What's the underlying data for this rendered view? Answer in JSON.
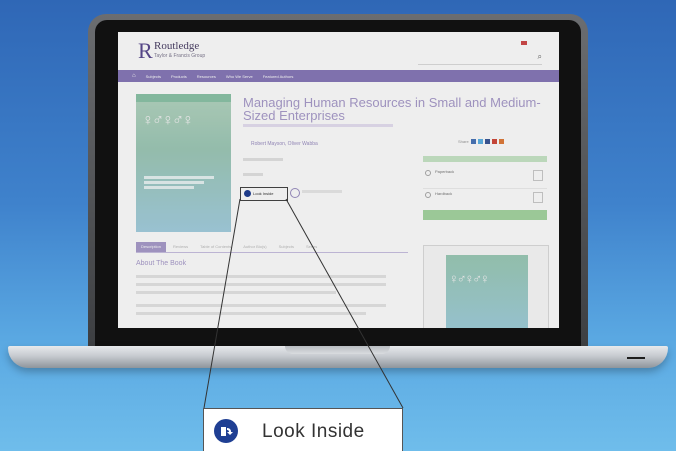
{
  "site": {
    "logo_letter": "R",
    "logo_name": "Routledge",
    "logo_tagline": "Taylor & Francis Group",
    "header_links": [
      "",
      "",
      ""
    ],
    "search_placeholder": ""
  },
  "nav": {
    "items": [
      "Subjects",
      "Products",
      "Resources",
      "Who We Serve",
      "Featured Authors"
    ]
  },
  "book": {
    "title": "Managing Human Resources in Small and Medium-Sized Enterprises",
    "authors": "Robert Mayson, Oliver Wabba",
    "look_inside_small": "Look Inside"
  },
  "tabs": [
    "Description",
    "Reviews",
    "Table of Contents",
    "Author Bio(s)",
    "Subjects",
    "Series"
  ],
  "about_heading": "About The Book",
  "purchase": {
    "share_label": "Share",
    "options": [
      {
        "name": "Paperback",
        "price": ""
      },
      {
        "name": "Hardback",
        "price": ""
      }
    ],
    "add_label": ""
  },
  "callout": {
    "label": "Look Inside",
    "icon": "book-open-icon"
  },
  "colors": {
    "brand_purple": "#8879b9",
    "accent_blue": "#1f3f93",
    "buy_green": "#a6d6a2"
  }
}
